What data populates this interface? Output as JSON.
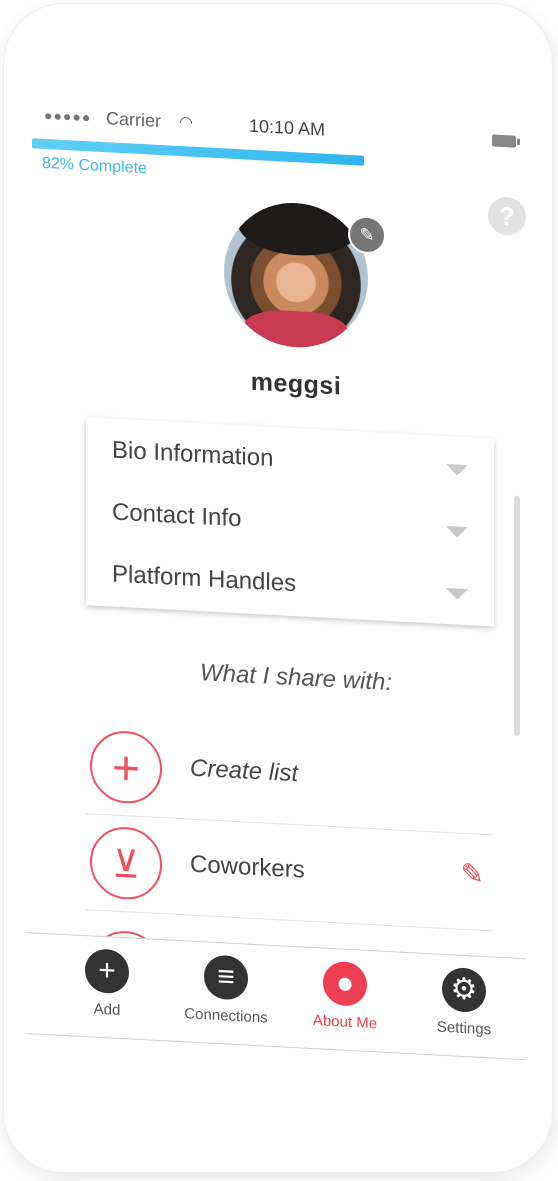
{
  "status_bar": {
    "signal": "●●●●●",
    "carrier": "Carrier",
    "time": "10:10 AM"
  },
  "progress": {
    "percent": 82,
    "label": "82% Complete"
  },
  "profile": {
    "username": "meggsi"
  },
  "sections": [
    {
      "label": "Bio Information"
    },
    {
      "label": "Contact Info"
    },
    {
      "label": "Platform Handles"
    }
  ],
  "share": {
    "title": "What I share with:",
    "items": [
      {
        "label": "Create list",
        "icon": "plus-icon"
      },
      {
        "label": "Coworkers",
        "icon": "tie-icon"
      }
    ]
  },
  "tabbar": {
    "tabs": [
      {
        "label": "Add",
        "icon": "plus-icon"
      },
      {
        "label": "Connections",
        "icon": "menu-icon"
      },
      {
        "label": "About Me",
        "icon": "user-icon"
      },
      {
        "label": "Settings",
        "icon": "gear-icon"
      }
    ],
    "active": "About Me"
  },
  "colors": {
    "accent": "#ee4053",
    "progress": "#2fb6ef"
  }
}
